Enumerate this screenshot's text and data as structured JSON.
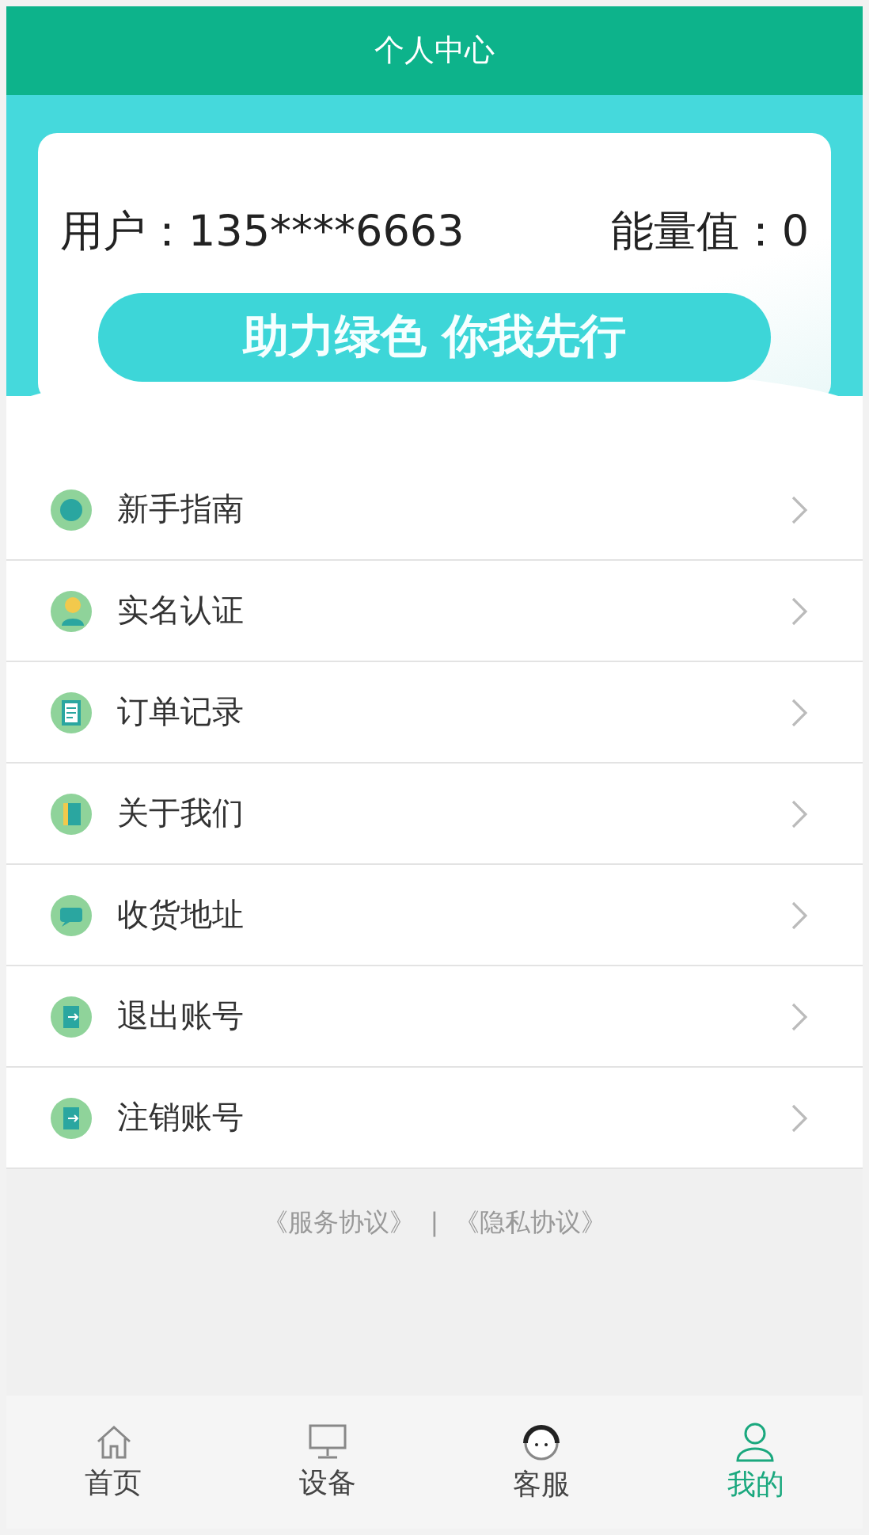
{
  "header": {
    "title": "个人中心"
  },
  "profile": {
    "user_label": "用户：135****6663",
    "energy_label": "能量值：0",
    "slogan": "助力绿色 你我先行"
  },
  "menu": [
    {
      "label": "新手指南"
    },
    {
      "label": "实名认证"
    },
    {
      "label": "订单记录"
    },
    {
      "label": "关于我们"
    },
    {
      "label": "收货地址"
    },
    {
      "label": "退出账号"
    },
    {
      "label": "注销账号"
    }
  ],
  "footer": {
    "links": [
      "《服务协议》",
      "《隐私协议》"
    ],
    "separator": "|"
  },
  "tabs": [
    {
      "label": "首页",
      "selected": false
    },
    {
      "label": "设备",
      "selected": false
    },
    {
      "label": "客服",
      "selected": false
    },
    {
      "label": "我的",
      "selected": true
    }
  ]
}
